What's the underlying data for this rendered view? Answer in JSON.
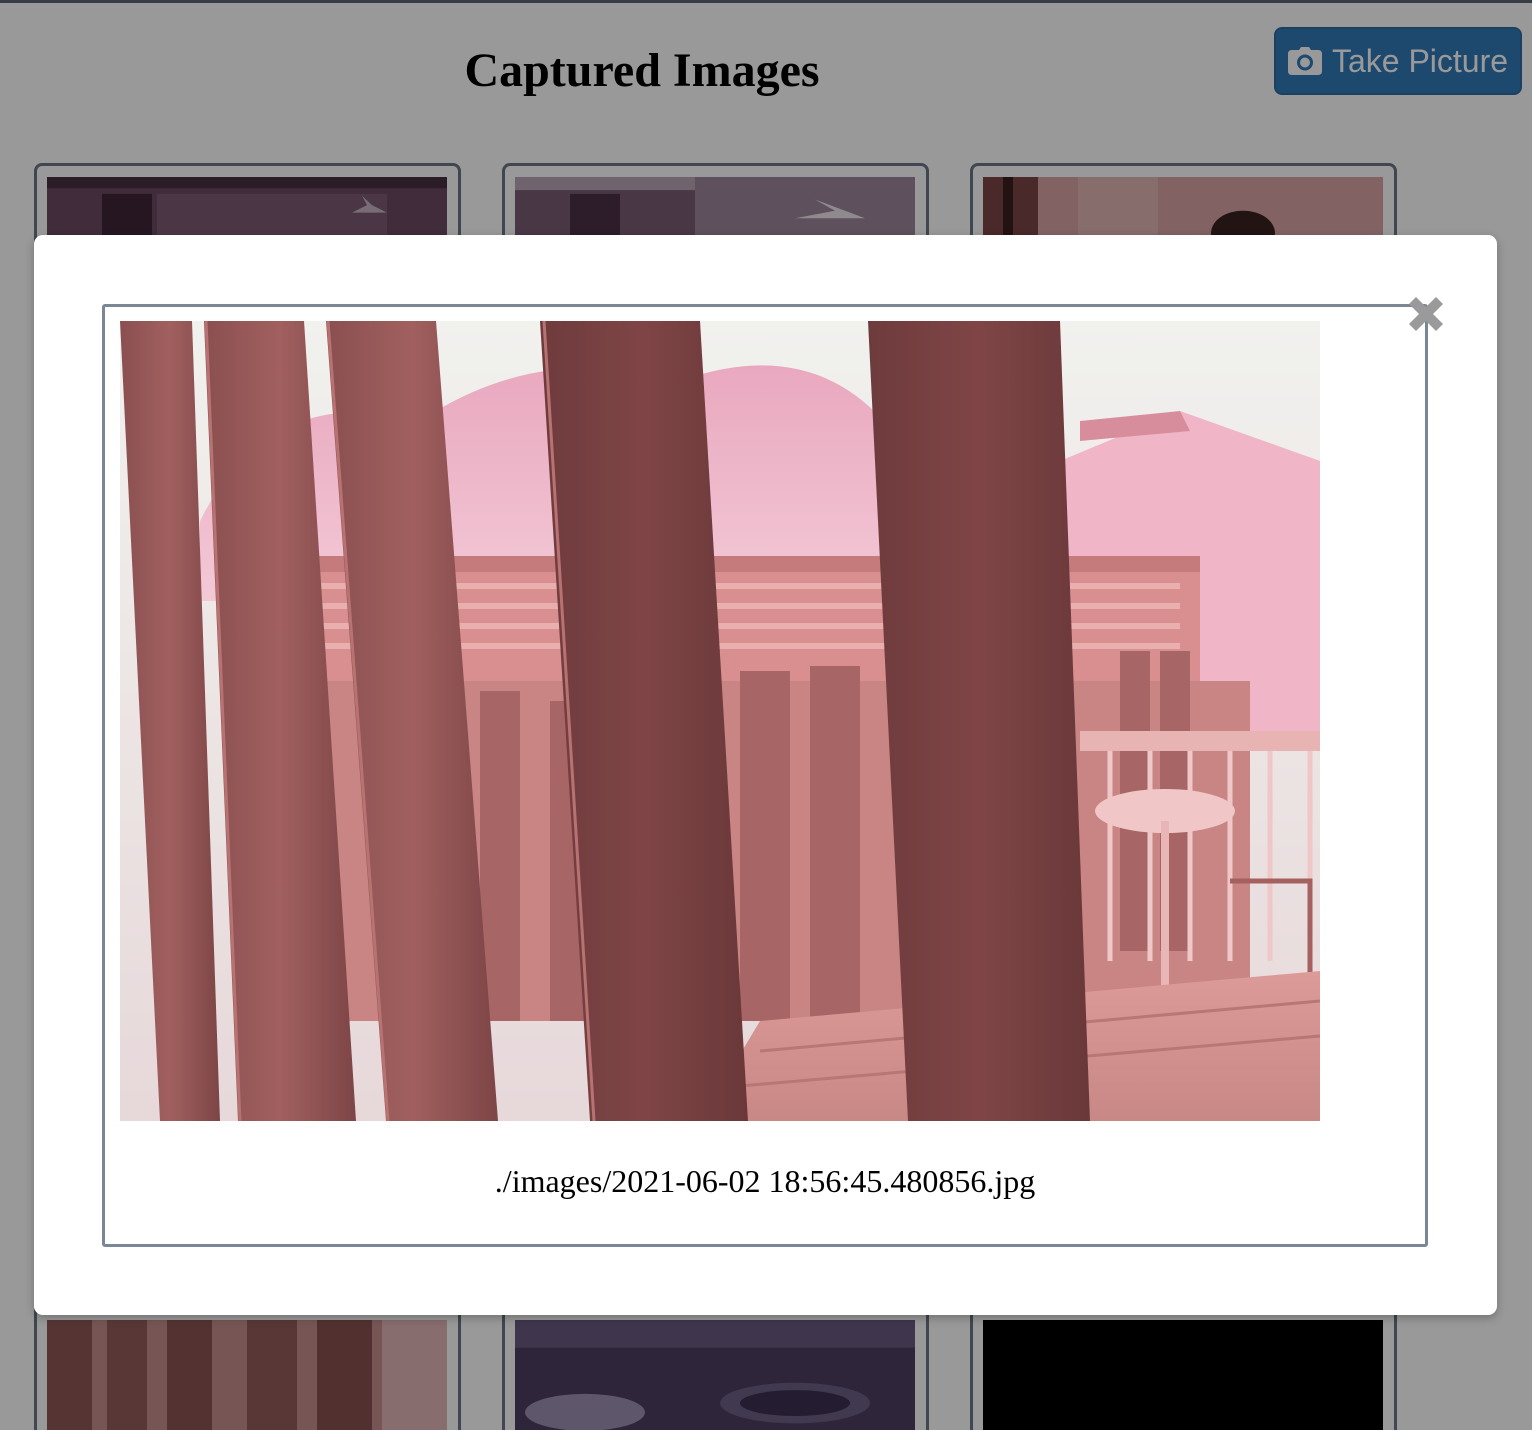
{
  "page": {
    "title": "Captured Images",
    "take_picture_label": "Take Picture"
  },
  "modal": {
    "caption": "./images/2021-06-02 18:56:45.480856.jpg",
    "close_icon": "close-x-icon"
  },
  "thumbnails": {
    "count_visible": 6
  },
  "colors": {
    "button_primary": "#337ab7",
    "card_border": "#6b7785",
    "overlay": "rgba(0,0,0,0.4)"
  }
}
